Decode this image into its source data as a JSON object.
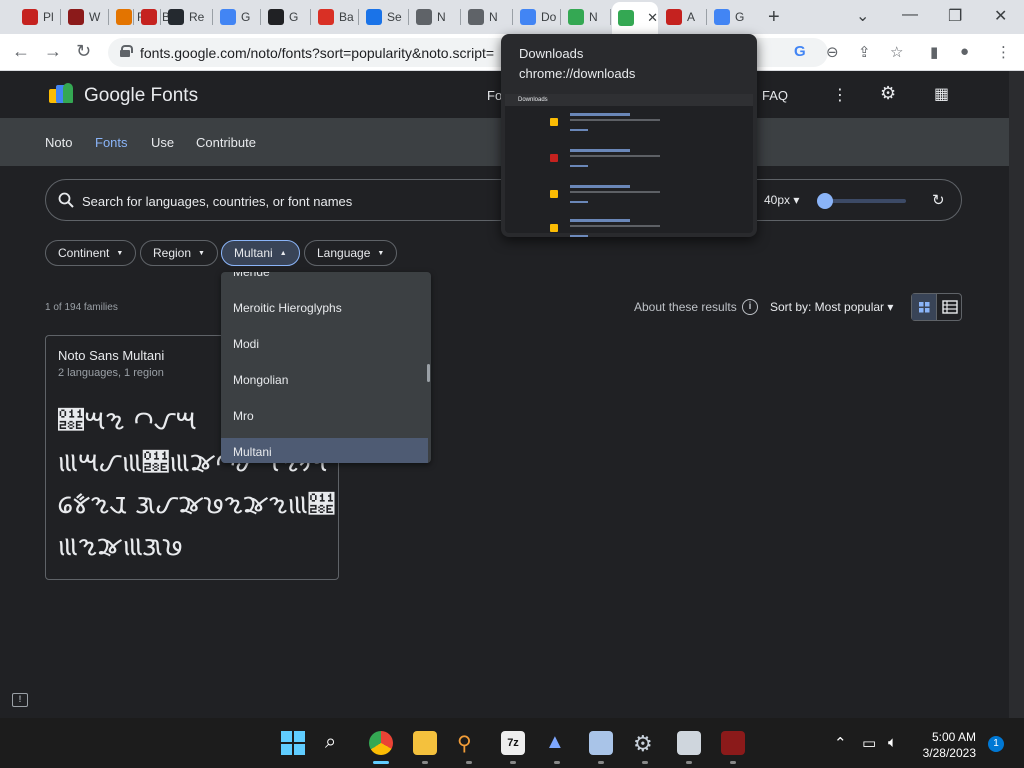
{
  "browser": {
    "tabs": [
      {
        "label": "Pl",
        "color": "#c5221f"
      },
      {
        "label": "W",
        "color": "#8b1a1a"
      },
      {
        "label": "Re",
        "color": "#e37400"
      },
      {
        "label": "Ba",
        "color": "#c5221f"
      },
      {
        "label": "Re",
        "color": "#24292f"
      },
      {
        "label": "G",
        "color": "#4285f4"
      },
      {
        "label": "G",
        "color": "#202124"
      },
      {
        "label": "Ba",
        "color": "#d93025"
      },
      {
        "label": "Se",
        "color": "#1a73e8"
      },
      {
        "label": "N",
        "color": "#5f6368"
      },
      {
        "label": "N",
        "color": "#5f6368"
      },
      {
        "label": "Do",
        "color": "#4285f4"
      },
      {
        "label": "N",
        "color": "#34a853"
      },
      {
        "label": "",
        "color": "#34a853",
        "active": true
      },
      {
        "label": "A",
        "color": "#c5221f"
      },
      {
        "label": "G",
        "color": "#4285f4"
      }
    ],
    "url": "fonts.google.com/noto/fonts?sort=popularity&noto.script=",
    "downloads_popup": {
      "title": "Downloads",
      "url": "chrome://downloads",
      "thumb_label": "Downloads"
    }
  },
  "header": {
    "brand": "Google Fonts",
    "links": [
      "Fo",
      "FAQ"
    ]
  },
  "subnav": {
    "items": [
      "Noto",
      "Fonts",
      "Use",
      "Contribute"
    ],
    "selected": "Fonts"
  },
  "search": {
    "placeholder": "Search for languages, countries, or font names",
    "size": "40px",
    "size_slider_fraction": 0.0
  },
  "filters": {
    "chips": [
      "Continent",
      "Region",
      "Multani",
      "Language"
    ],
    "active": "Multani"
  },
  "dropdown": {
    "options": [
      "Mende",
      "Meroitic Hieroglyphs",
      "Modi",
      "Mongolian",
      "Mro",
      "Multani"
    ],
    "selected": "Multani"
  },
  "results": {
    "count": "1 of 194 families",
    "about": "About these results",
    "sort": "Sort by: Most popular"
  },
  "card": {
    "name": "Noto Sans Multani",
    "meta": "2 languages, 1 region",
    "sample_lines": [
      "𑊎𑊈𑊘 𑊃𑊒𑊈",
      "𑊕𑊈𑊊𑊕𑊎𑊕𑊍𑊃𑊊𑊈𑊘𑊚𑊛",
      "𑊑𑊋𑊘𑊅 𑊌𑊊𑊍𑊔𑊘𑊍𑊘𑊕𑊎",
      "𑊕𑊘𑊍𑊕𑊌𑊔"
    ]
  },
  "taskbar": {
    "time": "5:00 AM",
    "date": "3/28/2023",
    "notifications": "1"
  }
}
